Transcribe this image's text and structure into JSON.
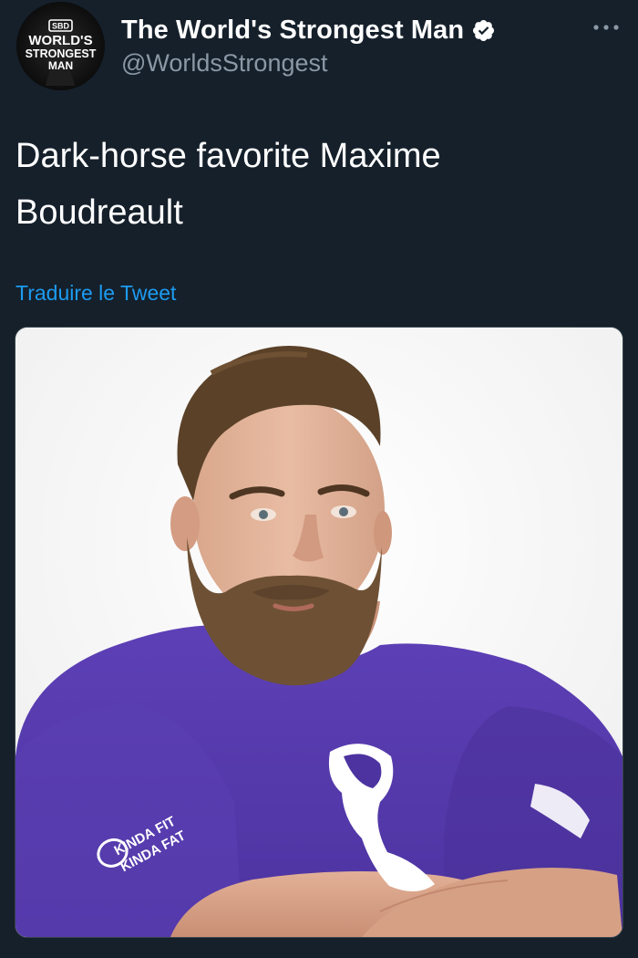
{
  "account": {
    "display_name": "The World's Strongest Man",
    "handle": "@WorldsStrongest",
    "verified": true,
    "avatar": {
      "top_badge": "SBD",
      "lines": [
        "WORLD'S",
        "STRONGEST",
        "MAN"
      ]
    }
  },
  "menu": {
    "icon": "more-dots-icon"
  },
  "tweet": {
    "text_line1": "Dark-horse favorite Maxime",
    "text_line2": "Boudreault",
    "translate_label": "Traduire le Tweet"
  },
  "media": {
    "shirt_sleeve_logo_line1": "KINDA FIT",
    "shirt_sleeve_logo_line2": "KINDA FAT"
  },
  "colors": {
    "background": "#15202b",
    "primary_text": "#ffffff",
    "secondary_text": "#8b98a5",
    "link": "#1d9bf0",
    "shirt": "#5b3fb0"
  }
}
